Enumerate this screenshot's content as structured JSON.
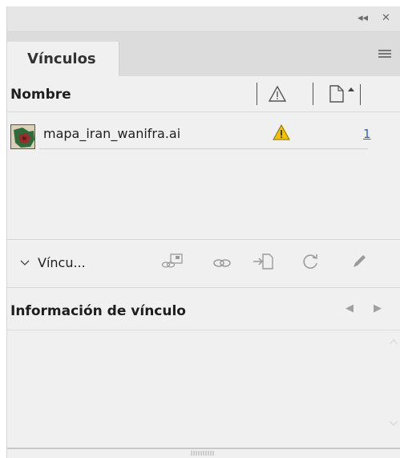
{
  "panel": {
    "collapse_glyph": "◂◂",
    "close_glyph": "✕",
    "tab_label": "Vínculos",
    "menu_icon": "hamburger-menu-icon"
  },
  "columns": {
    "name_label": "Nombre",
    "status_icon": "warning-triangle-icon",
    "page_icon": "page-icon",
    "sort_icon": "sort-up-icon"
  },
  "links": [
    {
      "filename": "mapa_iran_wanifra.ai",
      "status": "warning",
      "page": "1"
    }
  ],
  "toolbar": {
    "label": "Víncu...",
    "icons": [
      "relink-from-cc-icon",
      "relink-icon",
      "go-to-link-icon",
      "update-link-icon",
      "edit-original-icon"
    ]
  },
  "info": {
    "title": "Información de vínculo",
    "prev_glyph": "◀",
    "next_glyph": "▶"
  },
  "colors": {
    "warning": "#f2c200",
    "link_blue": "#2a63c9",
    "panel_bg": "#f0f0f0"
  }
}
